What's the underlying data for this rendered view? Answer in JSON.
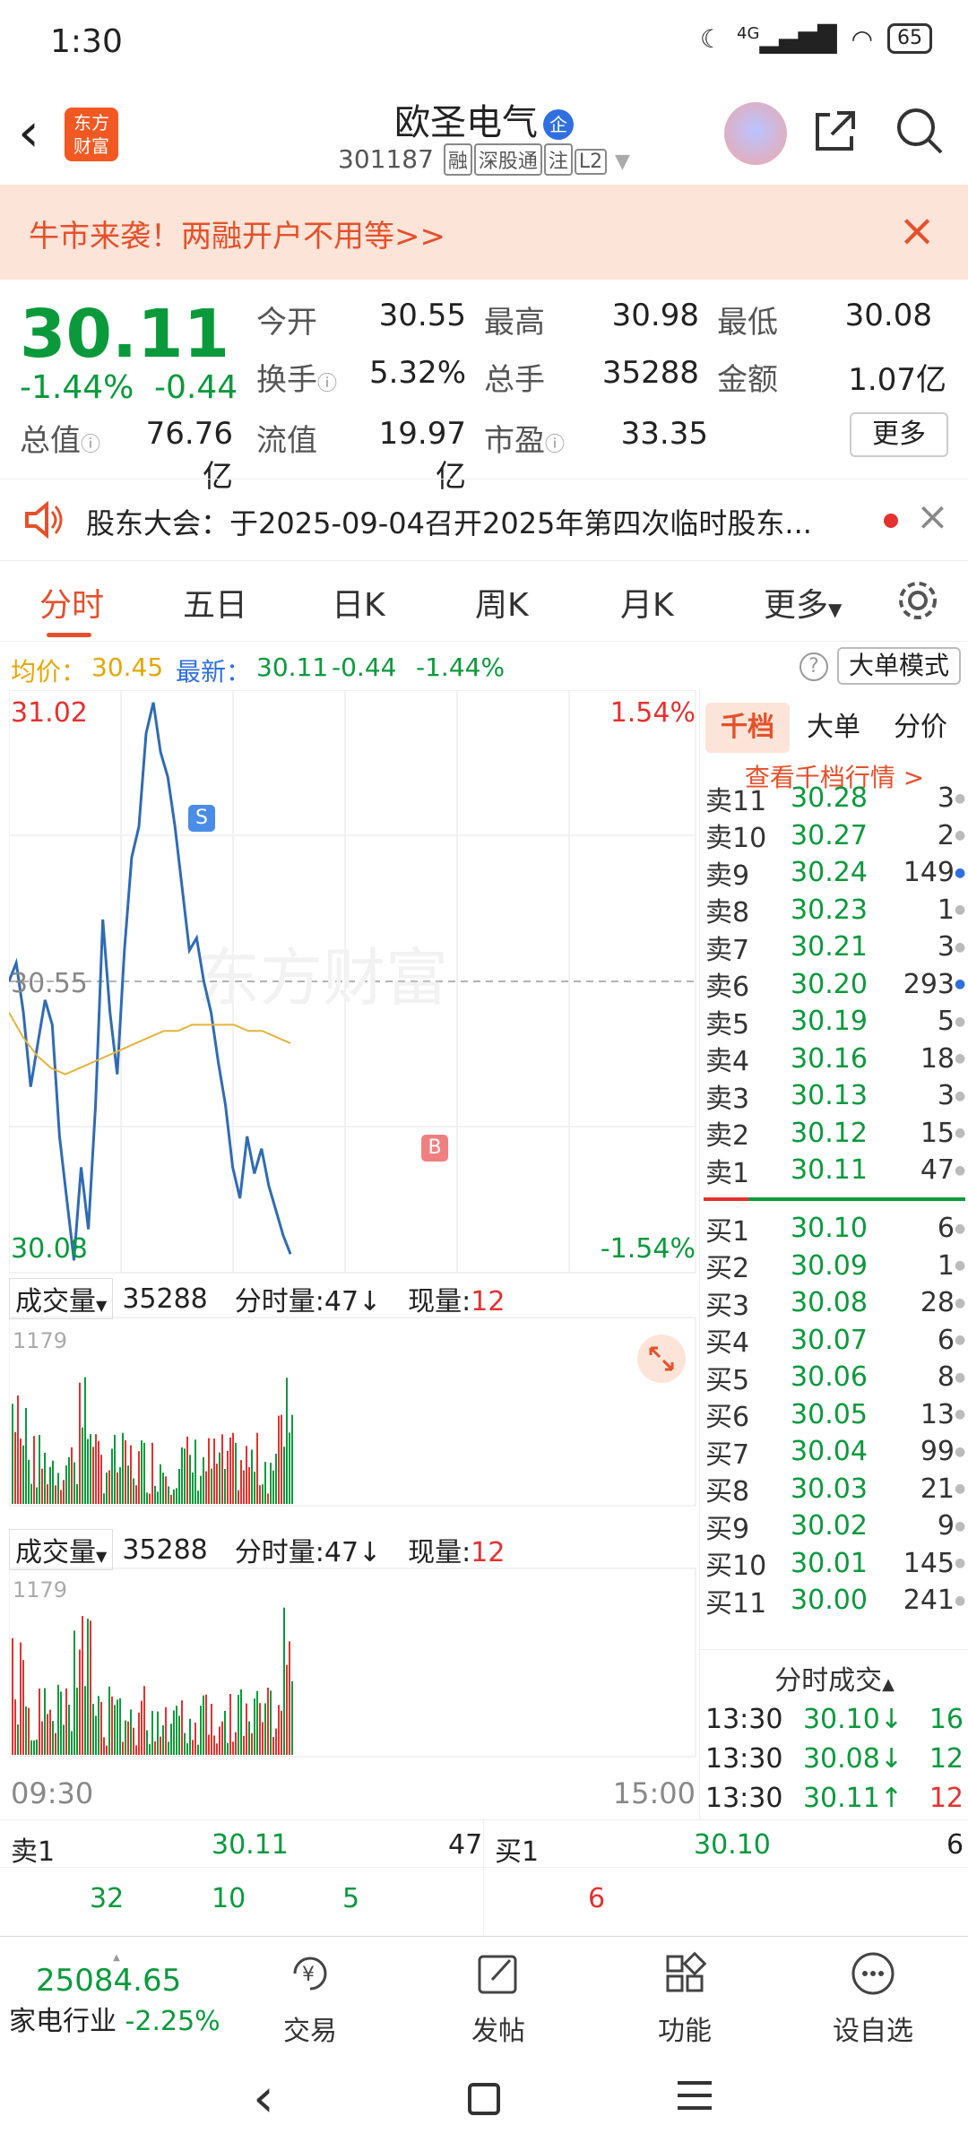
{
  "status": {
    "time": "1:30",
    "signal": "4G",
    "battery": "65"
  },
  "header": {
    "logo": "东方\n财富",
    "name": "欧圣电气",
    "badge": "企",
    "code": "301187",
    "tags": [
      "融",
      "深股通",
      "注",
      "L2"
    ]
  },
  "promo": {
    "text": "牛市来袭！两融开户不用等>>"
  },
  "quote": {
    "price": "30.11",
    "pct": "-1.44%",
    "chg": "-0.44",
    "rows": [
      [
        {
          "label": "今开",
          "value": "30.55",
          "color": "#222"
        },
        {
          "label": "最高",
          "value": "30.98",
          "color": "#e5312f"
        },
        {
          "label": "最低",
          "value": "30.08",
          "color": "#0a9a3c"
        }
      ],
      [
        {
          "label": "换手",
          "value": "5.32%",
          "color": "#222"
        },
        {
          "label": "总手",
          "value": "35288",
          "color": "#222"
        },
        {
          "label": "金额",
          "value": "1.07亿",
          "color": "#222"
        }
      ],
      [
        {
          "label": "总值",
          "value": "76.76亿",
          "color": "#222"
        },
        {
          "label": "流值",
          "value": "19.97亿",
          "color": "#222"
        },
        {
          "label": "市盈",
          "value": "33.35",
          "color": "#222"
        }
      ]
    ],
    "more": "更多"
  },
  "notice": {
    "text": "股东大会：于2025-09-04召开2025年第四次临时股东..."
  },
  "tabs": [
    "分时",
    "五日",
    "日K",
    "周K",
    "月K",
    "更多"
  ],
  "avg": {
    "avg_label": "均价：",
    "avg_value": "30.45",
    "latest_label": "最新：",
    "latest_value": "30.11",
    "chg": "-0.44",
    "pct": "-1.44%",
    "mode": "大单模式"
  },
  "chart": {
    "high": "31.02",
    "high_pct": "1.54%",
    "low": "30.08",
    "low_pct": "-1.54%",
    "mid": "30.55",
    "watermark": "东方财富",
    "marker_s": "S",
    "marker_b": "B",
    "vol_label": "成交量",
    "vol_total": "35288",
    "fen_label": "分时量:47↓",
    "now_label": "现量:",
    "now_value": "12",
    "vol_max": "1179",
    "time_start": "09:30",
    "time_end": "15:00"
  },
  "chart_data": {
    "type": "line",
    "title": "",
    "xlabel": "",
    "ylabel": "",
    "ylim": [
      30.08,
      31.02
    ],
    "x_range": [
      "09:30",
      "15:00"
    ],
    "series": [
      {
        "values": [
          30.55,
          30.58,
          30.5,
          30.38,
          30.45,
          30.52,
          30.48,
          30.3,
          30.2,
          30.1,
          30.25,
          30.15,
          30.35,
          30.65,
          30.5,
          30.4,
          30.6,
          30.75,
          30.8,
          30.95,
          31.0,
          30.92,
          30.88,
          30.8,
          30.7,
          30.6,
          30.62,
          30.55,
          30.5,
          30.42,
          30.35,
          30.25,
          30.2,
          30.3,
          30.24,
          30.28,
          30.22,
          30.18,
          30.14,
          30.11
        ]
      },
      {
        "values": [
          30.5,
          30.46,
          30.43,
          30.41,
          30.4,
          30.41,
          30.42,
          30.43,
          30.44,
          30.45,
          30.46,
          30.47,
          30.47,
          30.48,
          30.48,
          30.48,
          30.48,
          30.47,
          30.47,
          30.46,
          30.45
        ]
      }
    ]
  },
  "rpanel": {
    "tabs": [
      "千档",
      "大单",
      "分价"
    ],
    "link": "查看千档行情 >",
    "asks": [
      {
        "lbl": "卖11",
        "p": "30.28",
        "v": "3",
        "dot": "gray",
        "pc": "green"
      },
      {
        "lbl": "卖10",
        "p": "30.27",
        "v": "2",
        "dot": "gray",
        "pc": "green"
      },
      {
        "lbl": "卖9",
        "p": "30.24",
        "v": "149",
        "dot": "blue",
        "pc": "green"
      },
      {
        "lbl": "卖8",
        "p": "30.23",
        "v": "1",
        "dot": "gray",
        "pc": "green"
      },
      {
        "lbl": "卖7",
        "p": "30.21",
        "v": "3",
        "dot": "gray",
        "pc": "green"
      },
      {
        "lbl": "卖6",
        "p": "30.20",
        "v": "293",
        "dot": "blue",
        "pc": "green"
      },
      {
        "lbl": "卖5",
        "p": "30.19",
        "v": "5",
        "dot": "gray",
        "pc": "green"
      },
      {
        "lbl": "卖4",
        "p": "30.16",
        "v": "18",
        "dot": "gray",
        "pc": "green"
      },
      {
        "lbl": "卖3",
        "p": "30.13",
        "v": "3",
        "dot": "gray",
        "pc": "green"
      },
      {
        "lbl": "卖2",
        "p": "30.12",
        "v": "15",
        "dot": "gray",
        "pc": "green"
      },
      {
        "lbl": "卖1",
        "p": "30.11",
        "v": "47",
        "dot": "gray",
        "pc": "green"
      }
    ],
    "bids": [
      {
        "lbl": "买1",
        "p": "30.10",
        "v": "6",
        "dot": "gray",
        "pc": "green"
      },
      {
        "lbl": "买2",
        "p": "30.09",
        "v": "1",
        "dot": "gray",
        "pc": "green"
      },
      {
        "lbl": "买3",
        "p": "30.08",
        "v": "28",
        "dot": "gray",
        "pc": "green"
      },
      {
        "lbl": "买4",
        "p": "30.07",
        "v": "6",
        "dot": "gray",
        "pc": "green"
      },
      {
        "lbl": "买5",
        "p": "30.06",
        "v": "8",
        "dot": "gray",
        "pc": "green"
      },
      {
        "lbl": "买6",
        "p": "30.05",
        "v": "13",
        "dot": "gray",
        "pc": "green"
      },
      {
        "lbl": "买7",
        "p": "30.04",
        "v": "99",
        "dot": "gray",
        "pc": "green"
      },
      {
        "lbl": "买8",
        "p": "30.03",
        "v": "21",
        "dot": "gray",
        "pc": "green"
      },
      {
        "lbl": "买9",
        "p": "30.02",
        "v": "9",
        "dot": "gray",
        "pc": "green"
      },
      {
        "lbl": "买10",
        "p": "30.01",
        "v": "145",
        "dot": "gray",
        "pc": "green"
      },
      {
        "lbl": "买11",
        "p": "30.00",
        "v": "241",
        "dot": "gray",
        "pc": "green"
      }
    ],
    "trades_title": "分时成交",
    "trades": [
      {
        "t": "13:30",
        "p": "30.10↓",
        "v": "16",
        "pc": "green",
        "vc": "green"
      },
      {
        "t": "13:30",
        "p": "30.08↓",
        "v": "12",
        "pc": "green",
        "vc": "green"
      },
      {
        "t": "13:30",
        "p": "30.11↑",
        "v": "12",
        "pc": "green",
        "vc": "red"
      }
    ]
  },
  "bottom_quotes": {
    "ask_label": "卖1",
    "ask_price": "30.11",
    "ask_vol": "47",
    "bid_label": "买1",
    "bid_price": "30.10",
    "bid_vol": "6",
    "ask_splits": [
      "32",
      "10",
      "5"
    ],
    "bid_splits": [
      "6"
    ]
  },
  "bottombar": {
    "index_value": "25084.65",
    "index_name": "家电行业",
    "index_pct": "-2.25%",
    "items": [
      "交易",
      "发帖",
      "功能",
      "设自选"
    ]
  }
}
